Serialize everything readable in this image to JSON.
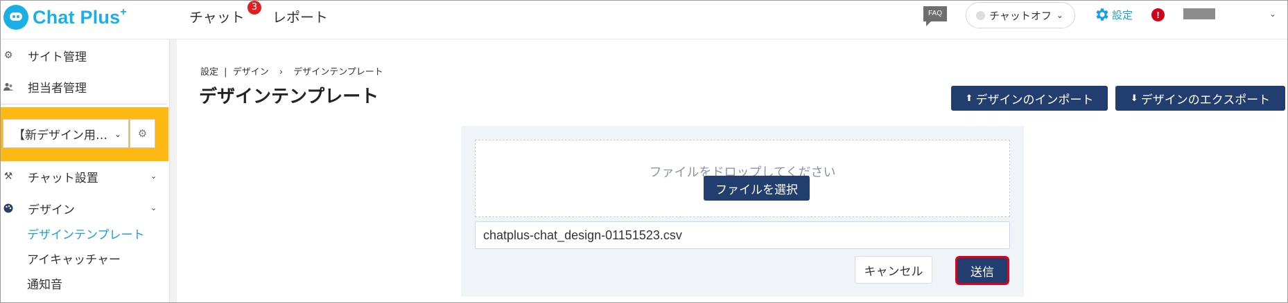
{
  "header": {
    "logo_text": "Chat Plus",
    "logo_sup": "+",
    "nav_chat": "チャット",
    "nav_chat_badge": "3",
    "nav_report": "レポート",
    "faq": "FAQ",
    "chat_status": "チャットオフ",
    "settings": "設定",
    "alert": "!"
  },
  "sidebar": {
    "site_mgmt": "サイト管理",
    "staff_mgmt": "担当者管理",
    "site_select": "【新デザイン用…",
    "chat_setup": "チャット設置",
    "design": "デザイン",
    "design_template": "デザインテンプレート",
    "eye_catcher": "アイキャッチャー",
    "notification_sound": "通知音"
  },
  "main": {
    "breadcrumb": [
      "設定",
      "デザイン",
      "デザインテンプレート"
    ],
    "breadcrumb_pipe": "|",
    "breadcrumb_arrow": "›",
    "title": "デザインテンプレート",
    "import_button": "デザインのインポート",
    "export_button": "デザインのエクスポート",
    "drop_text": "ファイルをドロップしてください",
    "choose_file_button": "ファイルを選択",
    "file_name": "chatplus-chat_design-01151523.csv",
    "cancel_button": "キャンセル",
    "send_button": "送信"
  },
  "colors": {
    "brand": "#1ab0e6",
    "primary_button": "#223e6e",
    "highlight": "#fdb813",
    "send_outline": "#e0001b",
    "active_link": "#1a9fe0"
  }
}
